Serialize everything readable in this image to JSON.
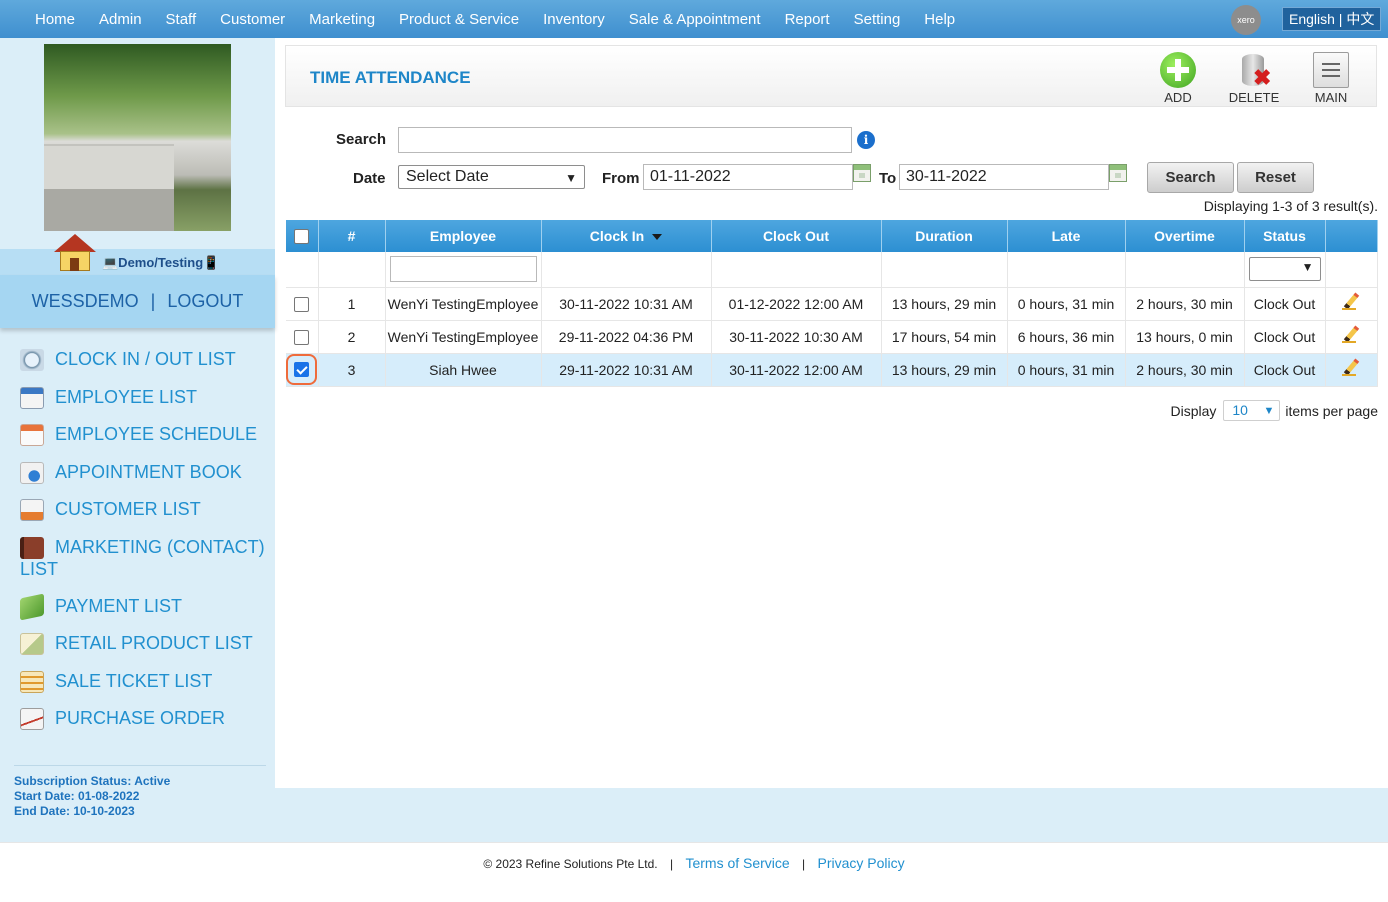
{
  "nav": {
    "items": [
      "Home",
      "Admin",
      "Staff",
      "Customer",
      "Marketing",
      "Product & Service",
      "Inventory",
      "Sale & Appointment",
      "Report",
      "Setting",
      "Help"
    ],
    "xero_label": "xero",
    "language": "English | 中文"
  },
  "sidebar": {
    "company": "💻Demo/Testing📱",
    "account": "WESSDEMO",
    "separator": "|",
    "logout": "LOGOUT",
    "links": [
      "CLOCK IN / OUT LIST",
      "EMPLOYEE LIST",
      "EMPLOYEE SCHEDULE",
      "APPOINTMENT BOOK",
      "CUSTOMER LIST",
      "MARKETING (CONTACT) LIST",
      "PAYMENT LIST",
      "RETAIL PRODUCT LIST",
      "SALE TICKET LIST",
      "PURCHASE ORDER"
    ],
    "subscription": {
      "status": "Subscription Status: Active",
      "start": "Start Date: 01-08-2022",
      "end": "End Date: 10-10-2023"
    }
  },
  "page": {
    "title": "TIME ATTENDANCE",
    "toolbar": {
      "add": "ADD",
      "delete": "DELETE",
      "main": "MAIN"
    }
  },
  "filters": {
    "search_label": "Search",
    "search_value": "",
    "info_glyph": "i",
    "date_label": "Date",
    "date_select": "Select Date",
    "from_label": "From",
    "from_value": "01-11-2022",
    "to_label": "To",
    "to_value": "30-11-2022",
    "search_button": "Search",
    "reset_button": "Reset"
  },
  "results": "Displaying 1-3 of 3 result(s).",
  "table": {
    "headers": {
      "num": "#",
      "employee": "Employee",
      "clock_in": "Clock In",
      "clock_out": "Clock Out",
      "duration": "Duration",
      "late": "Late",
      "overtime": "Overtime",
      "status": "Status"
    },
    "rows": [
      {
        "num": "1",
        "employee": "WenYi TestingEmployee",
        "clock_in": "30-11-2022 10:31 AM",
        "clock_out": "01-12-2022 12:00 AM",
        "duration": "13 hours, 29 min",
        "late": "0 hours, 31 min",
        "overtime": "2 hours, 30 min",
        "status": "Clock Out"
      },
      {
        "num": "2",
        "employee": "WenYi TestingEmployee",
        "clock_in": "29-11-2022 04:36 PM",
        "clock_out": "30-11-2022 10:30 AM",
        "duration": "17 hours, 54 min",
        "late": "6 hours, 36 min",
        "overtime": "13 hours, 0 min",
        "status": "Clock Out"
      },
      {
        "num": "3",
        "employee": "Siah Hwee",
        "clock_in": "29-11-2022 10:31 AM",
        "clock_out": "30-11-2022 12:00 AM",
        "duration": "13 hours, 29 min",
        "late": "0 hours, 31 min",
        "overtime": "2 hours, 30 min",
        "status": "Clock Out"
      }
    ]
  },
  "pager": {
    "display": "Display",
    "per_page": "10",
    "items_per_page": "items per page"
  },
  "footer": {
    "copyright": "© 2023 Refine Solutions Pte Ltd.",
    "separator": "|",
    "terms": "Terms of Service",
    "privacy": "Privacy Policy"
  }
}
